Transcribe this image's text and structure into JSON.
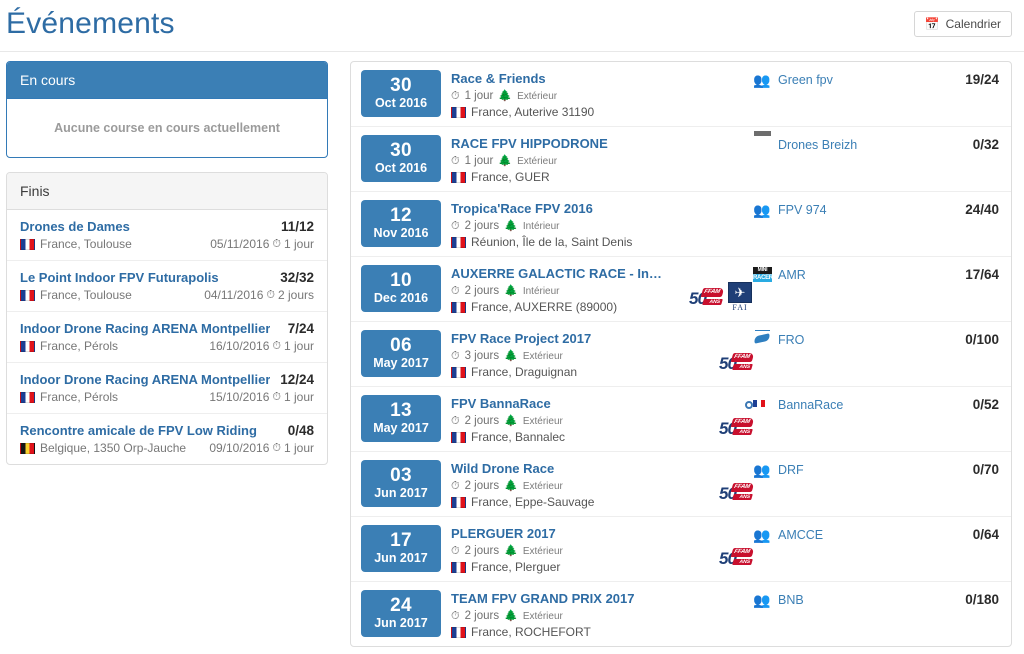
{
  "header": {
    "title": "Événements",
    "calendar_button": "Calendrier",
    "calendar_icon": "calendar-icon"
  },
  "sidebar": {
    "ongoing": {
      "heading": "En cours",
      "empty_message": "Aucune course en cours actuellement"
    },
    "finished": {
      "heading": "Finis",
      "items": [
        {
          "title": "Drones de Dames",
          "count": "11/12",
          "flag": "fr",
          "location": "France, Toulouse",
          "date": "05/11/2016",
          "duration": "1 jour"
        },
        {
          "title": "Le Point Indoor FPV Futurapolis",
          "count": "32/32",
          "flag": "fr",
          "location": "France, Toulouse",
          "date": "04/11/2016",
          "duration": "2 jours"
        },
        {
          "title": "Indoor Drone Racing ARENA Montpellier",
          "count": "7/24",
          "flag": "fr",
          "location": "France, Pérols",
          "date": "16/10/2016",
          "duration": "1 jour"
        },
        {
          "title": "Indoor Drone Racing ARENA Montpellier",
          "count": "12/24",
          "flag": "fr",
          "location": "France, Pérols",
          "date": "15/10/2016",
          "duration": "1 jour"
        },
        {
          "title": "Rencontre amicale de FPV Low Riding",
          "count": "0/48",
          "flag": "be",
          "location": "Belgique, 1350 Orp-Jauche",
          "date": "09/10/2016",
          "duration": "1 jour"
        }
      ]
    }
  },
  "events": [
    {
      "day": "30",
      "month_year": "Oct 2016",
      "title": "Race & Friends",
      "duration": "1 jour",
      "venue": "Extérieur",
      "flag": "fr",
      "location": "France, Auterive 31190",
      "badges": [],
      "organizer": "Green fpv",
      "organizer_avatar": "people-icon",
      "count": "19/24"
    },
    {
      "day": "30",
      "month_year": "Oct 2016",
      "title": "RACE FPV HIPPODRONE",
      "duration": "1 jour",
      "venue": "Extérieur",
      "flag": "fr",
      "location": "France, GUER",
      "badges": [],
      "organizer": "Drones Breizh",
      "organizer_avatar": "drones-breizh-logo",
      "count": "0/32"
    },
    {
      "day": "12",
      "month_year": "Nov 2016",
      "title": "Tropica'Race FPV 2016",
      "duration": "2 jours",
      "venue": "Intérieur",
      "flag": "fr",
      "location": "Réunion, Île de la, Saint Denis",
      "badges": [],
      "organizer": "FPV 974",
      "organizer_avatar": "people-icon",
      "count": "24/40"
    },
    {
      "day": "10",
      "month_year": "Dec 2016",
      "title": "AUXERRE GALACTIC RACE - Indoor",
      "duration": "2 jours",
      "venue": "Intérieur",
      "flag": "fr",
      "location": "France, AUXERRE (89000)",
      "badges": [
        "ffam-50-ans-logo",
        "fai-logo"
      ],
      "organizer": "AMR",
      "organizer_avatar": "mini-racers-logo",
      "count": "17/64"
    },
    {
      "day": "06",
      "month_year": "May 2017",
      "title": "FPV Race Project 2017",
      "duration": "3 jours",
      "venue": "Extérieur",
      "flag": "fr",
      "location": "France, Draguignan",
      "badges": [
        "ffam-50-ans-logo"
      ],
      "organizer": "FRO",
      "organizer_avatar": "fro-logo",
      "count": "0/100"
    },
    {
      "day": "13",
      "month_year": "May 2017",
      "title": "FPV BannaRace",
      "duration": "2 jours",
      "venue": "Extérieur",
      "flag": "fr",
      "location": "France, Bannalec",
      "badges": [
        "ffam-50-ans-logo"
      ],
      "organizer": "BannaRace",
      "organizer_avatar": "bannarace-logo",
      "count": "0/52"
    },
    {
      "day": "03",
      "month_year": "Jun 2017",
      "title": "Wild Drone Race",
      "duration": "2 jours",
      "venue": "Extérieur",
      "flag": "fr",
      "location": "France, Eppe-Sauvage",
      "badges": [
        "ffam-50-ans-logo"
      ],
      "organizer": "DRF",
      "organizer_avatar": "people-icon",
      "count": "0/70"
    },
    {
      "day": "17",
      "month_year": "Jun 2017",
      "title": "PLERGUER 2017",
      "duration": "2 jours",
      "venue": "Extérieur",
      "flag": "fr",
      "location": "France, Plerguer",
      "badges": [
        "ffam-50-ans-logo"
      ],
      "organizer": "AMCCE",
      "organizer_avatar": "people-icon",
      "count": "0/64"
    },
    {
      "day": "24",
      "month_year": "Jun 2017",
      "title": "TEAM FPV GRAND PRIX 2017",
      "duration": "2 jours",
      "venue": "Extérieur",
      "flag": "fr",
      "location": "France, ROCHEFORT",
      "badges": [],
      "organizer": "BNB",
      "organizer_avatar": "people-icon",
      "count": "0/180"
    }
  ],
  "colors": {
    "accent_blue": "#3b7fb5",
    "link_blue": "#2e6ca4",
    "panel_border": "#dddddd"
  }
}
